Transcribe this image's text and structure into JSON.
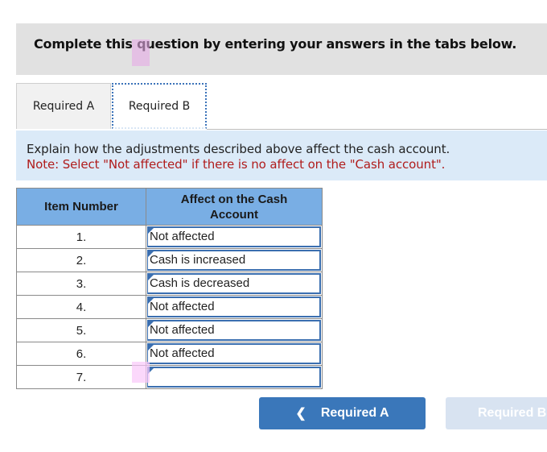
{
  "header": {
    "title": "Complete this question by entering your answers in the tabs below."
  },
  "tabs": [
    {
      "label": "Required A",
      "active": false
    },
    {
      "label": "Required B",
      "active": true
    }
  ],
  "instructions": {
    "prompt": "Explain how the adjustments described above affect the cash account.",
    "note": "Note: Select \"Not affected\" if there is no affect on the \"Cash account\"."
  },
  "table": {
    "headers": [
      "Item Number",
      "Affect on the Cash Account"
    ],
    "rows": [
      {
        "item": "1.",
        "affect": "Not affected"
      },
      {
        "item": "2.",
        "affect": "Cash is increased"
      },
      {
        "item": "3.",
        "affect": "Cash is decreased"
      },
      {
        "item": "4.",
        "affect": "Not affected"
      },
      {
        "item": "5.",
        "affect": "Not affected"
      },
      {
        "item": "6.",
        "affect": "Not affected"
      },
      {
        "item": "7.",
        "affect": ""
      }
    ]
  },
  "navigation": {
    "prev_label": "Required A",
    "prev_icon": "chevron-left-icon",
    "next_label": "Required B"
  },
  "colors": {
    "accent": "#3a77ba",
    "note_red": "#b01c1c",
    "table_header": "#79aee4",
    "instruction_bg": "#dbeaf8"
  }
}
